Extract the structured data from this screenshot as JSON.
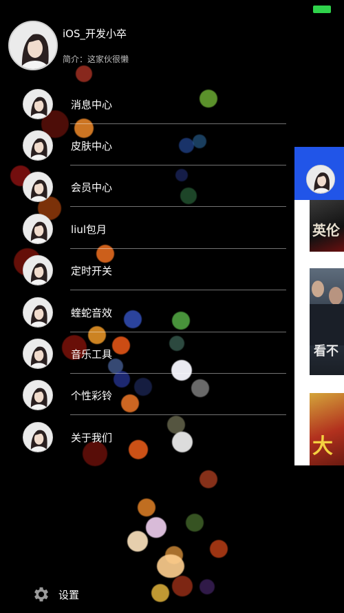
{
  "profile": {
    "username": "iOS_开发小卒",
    "bio": "简介：这家伙很懒"
  },
  "menu": {
    "items": [
      {
        "label": "消息中心"
      },
      {
        "label": "皮肤中心"
      },
      {
        "label": "会员中心"
      },
      {
        "label": "liul包月"
      },
      {
        "label": "定时开关"
      },
      {
        "label": "蝰蛇音效"
      },
      {
        "label": "音乐工具"
      },
      {
        "label": "个性彩铃"
      },
      {
        "label": "关于我们"
      }
    ]
  },
  "footer": {
    "settings_label": "设置",
    "settings_icon": "gear-icon"
  },
  "main_content": {
    "poster_texts": [
      "英伦",
      "看不",
      "大"
    ]
  },
  "colors": {
    "background": "#000000",
    "header_blue": "#2155e8",
    "battery_green": "#2fd24b",
    "divider": "#8c8c8c"
  }
}
